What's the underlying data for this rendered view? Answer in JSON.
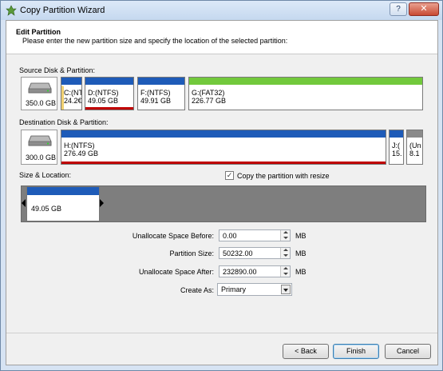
{
  "window": {
    "title": "Copy Partition Wizard",
    "help": "?",
    "close": "✕"
  },
  "header": {
    "title": "Edit Partition",
    "subtitle": "Please enter the new partition size and specify the location of the selected partition:"
  },
  "source": {
    "label": "Source Disk & Partition:",
    "disk_size": "350.0 GB",
    "partitions": [
      {
        "line1": "C:(NT",
        "line2": "24.2€",
        "bar_color": "#1e5bb8"
      },
      {
        "line1": "D:(NTFS)",
        "line2": "49.05 GB",
        "bar_color": "#1e5bb8"
      },
      {
        "line1": "F:(NTFS)",
        "line2": "49.91 GB",
        "bar_color": "#1e5bb8"
      },
      {
        "line1": "G:(FAT32)",
        "line2": "226.77 GB",
        "bar_color": "#72c93c"
      }
    ]
  },
  "destination": {
    "label": "Destination Disk & Partition:",
    "disk_size": "300.0 GB",
    "partitions": [
      {
        "line1": "H:(NTFS)",
        "line2": "276.49 GB",
        "bar_color": "#1e5bb8"
      },
      {
        "line1": "J:(",
        "line2": "15.",
        "bar_color": "#1e5bb8"
      },
      {
        "line1": "(Un",
        "line2": "8.1",
        "bar_color": "#8a8a8a"
      }
    ]
  },
  "size_location": {
    "label": "Size & Location:",
    "checkbox_label": "Copy the partition with resize",
    "checkbox_mark": "✓",
    "partition_size": "49.05 GB"
  },
  "fields": {
    "before": {
      "label": "Unallocate Space Before:",
      "value": "0.00",
      "unit": "MB"
    },
    "size": {
      "label": "Partition Size:",
      "value": "50232.00",
      "unit": "MB"
    },
    "after": {
      "label": "Unallocate Space After:",
      "value": "232890.00",
      "unit": "MB"
    },
    "create_as": {
      "label": "Create As:",
      "value": "Primary"
    }
  },
  "buttons": {
    "back": "< Back",
    "finish": "Finish",
    "cancel": "Cancel"
  }
}
